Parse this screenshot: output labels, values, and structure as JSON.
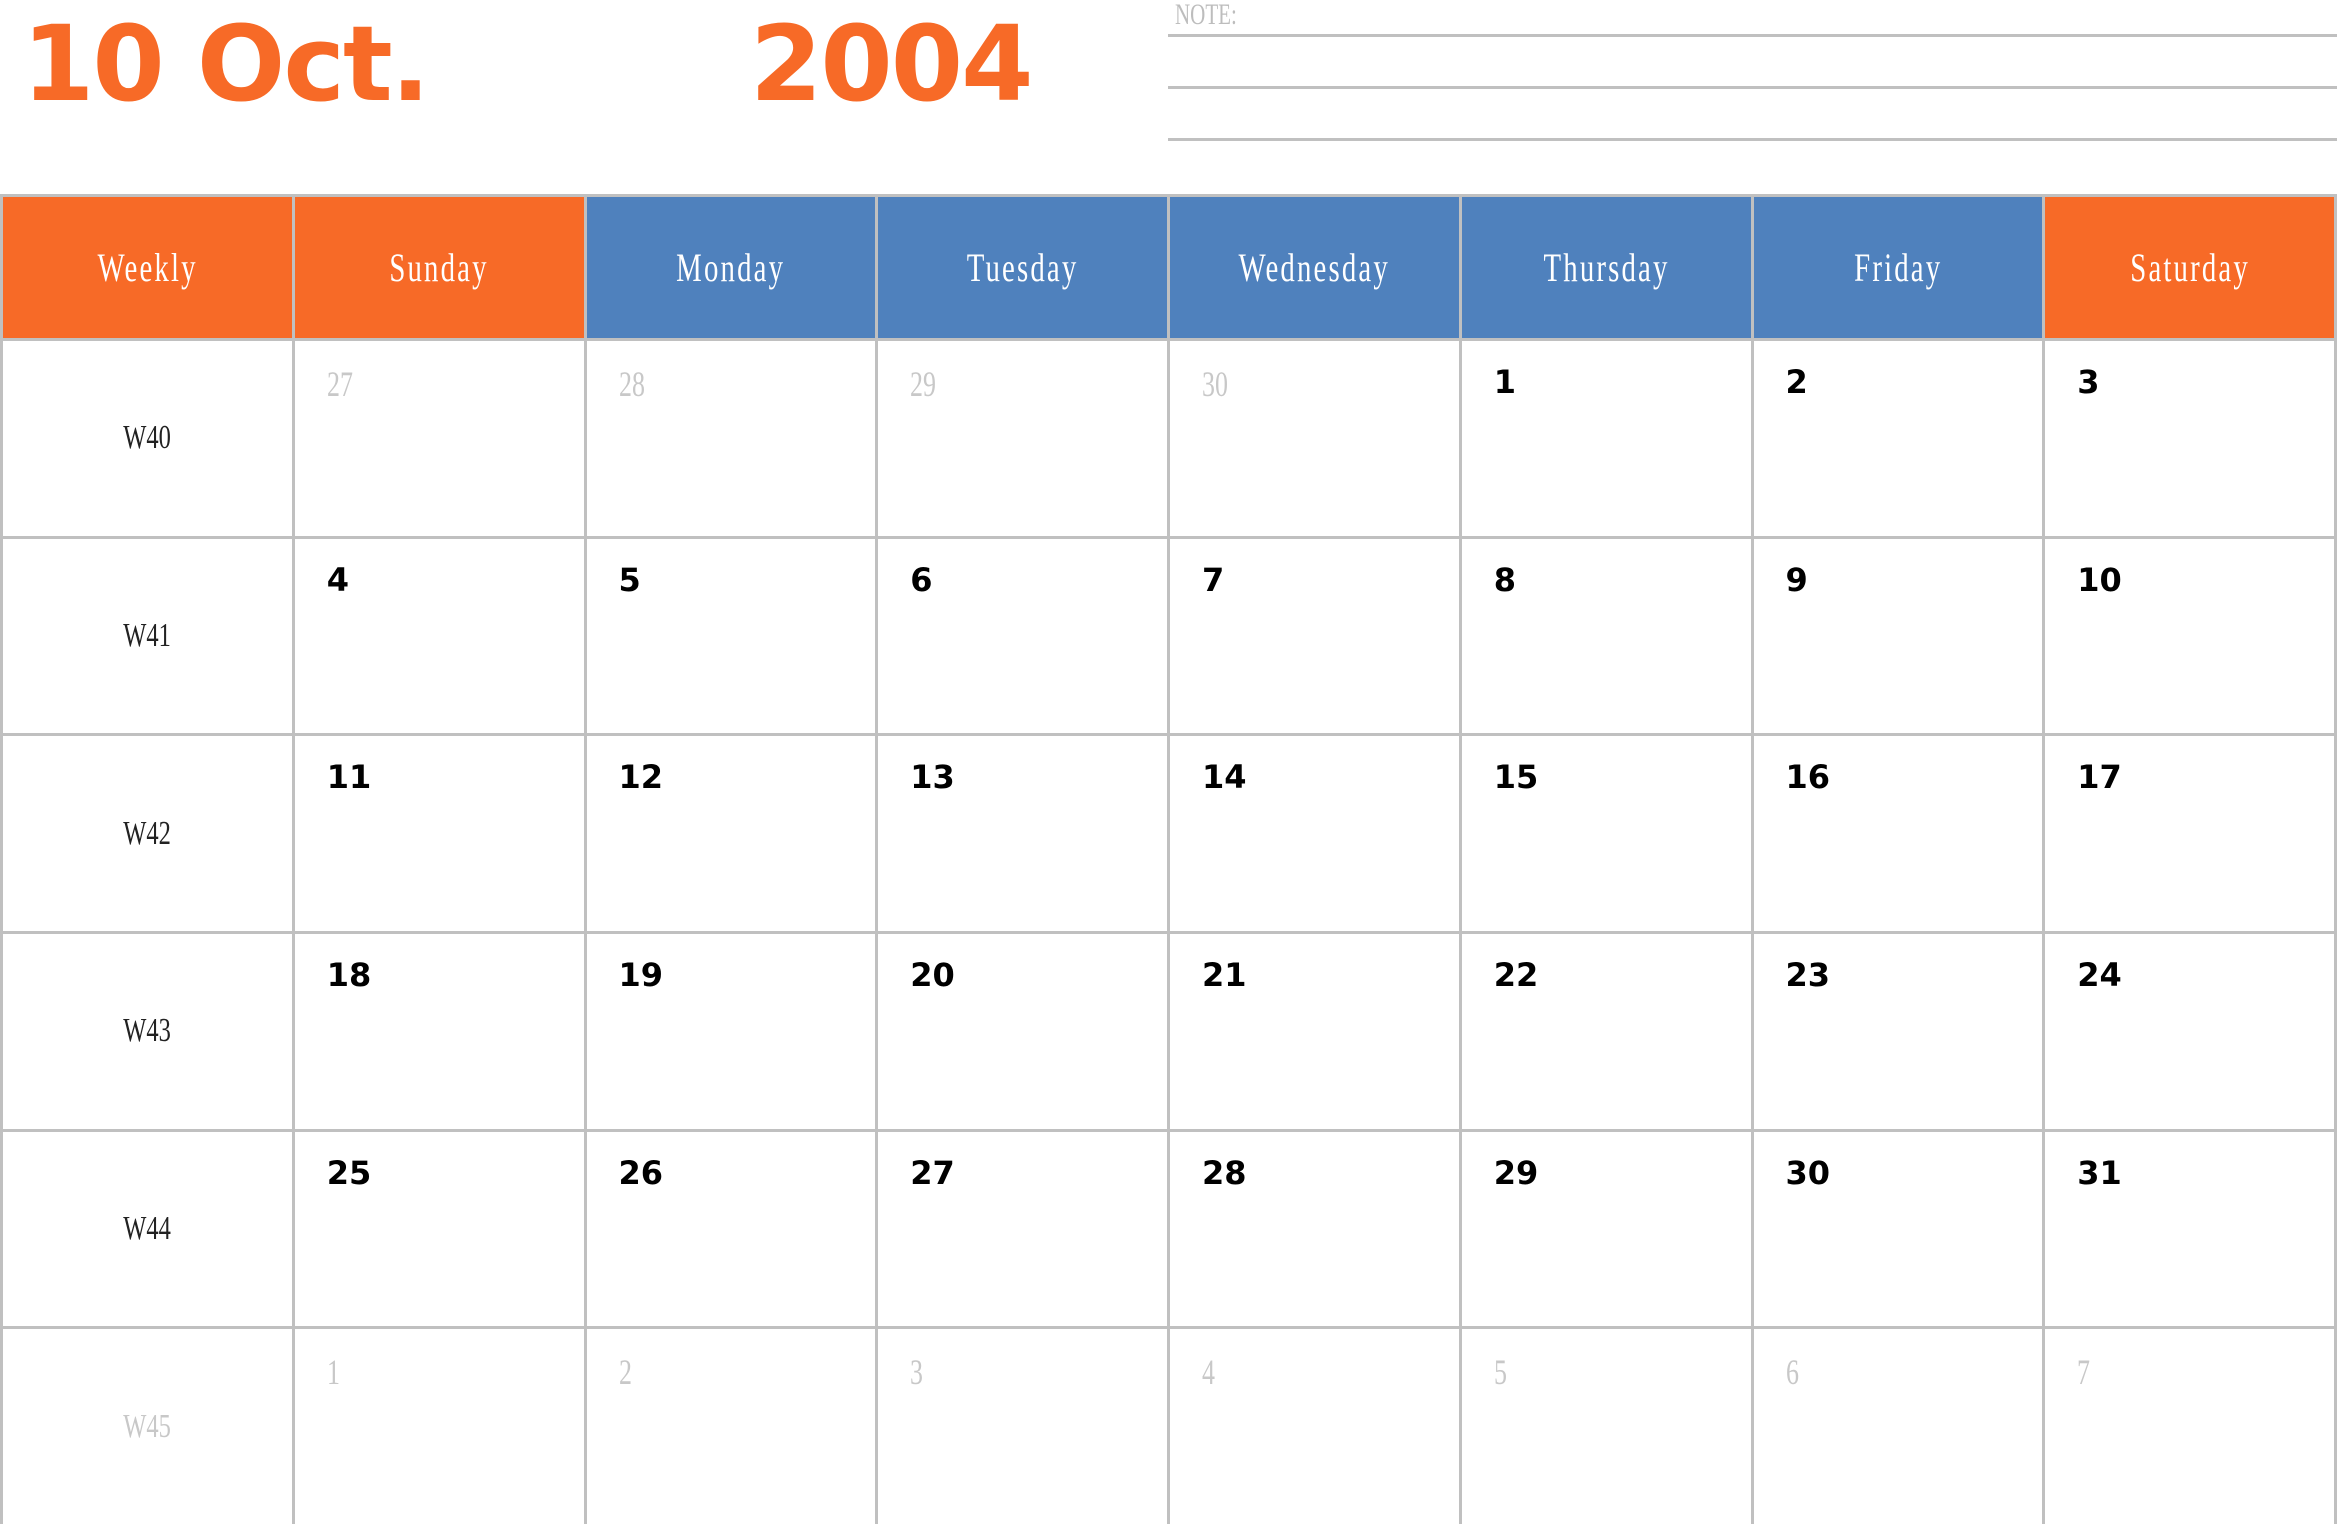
{
  "header": {
    "date_label": "10 Oct.",
    "year": "2004",
    "note_label": "NOTE:"
  },
  "colors": {
    "accent_orange": "#f76a27",
    "accent_blue": "#4f81bd",
    "grid_gray": "#c0c0c0",
    "muted_text": "#c8c8c8"
  },
  "columns": [
    {
      "label": "Weekly",
      "color": "orange"
    },
    {
      "label": "Sunday",
      "color": "orange"
    },
    {
      "label": "Monday",
      "color": "blue"
    },
    {
      "label": "Tuesday",
      "color": "blue"
    },
    {
      "label": "Wednesday",
      "color": "blue"
    },
    {
      "label": "Thursday",
      "color": "blue"
    },
    {
      "label": "Friday",
      "color": "blue"
    },
    {
      "label": "Saturday",
      "color": "orange"
    }
  ],
  "weeks": [
    {
      "week": "W40",
      "muted": false,
      "days": [
        {
          "d": "27",
          "muted": true
        },
        {
          "d": "28",
          "muted": true
        },
        {
          "d": "29",
          "muted": true
        },
        {
          "d": "30",
          "muted": true
        },
        {
          "d": "1",
          "muted": false
        },
        {
          "d": "2",
          "muted": false
        },
        {
          "d": "3",
          "muted": false
        }
      ]
    },
    {
      "week": "W41",
      "muted": false,
      "days": [
        {
          "d": "4",
          "muted": false
        },
        {
          "d": "5",
          "muted": false
        },
        {
          "d": "6",
          "muted": false
        },
        {
          "d": "7",
          "muted": false
        },
        {
          "d": "8",
          "muted": false
        },
        {
          "d": "9",
          "muted": false
        },
        {
          "d": "10",
          "muted": false
        }
      ]
    },
    {
      "week": "W42",
      "muted": false,
      "days": [
        {
          "d": "11",
          "muted": false
        },
        {
          "d": "12",
          "muted": false
        },
        {
          "d": "13",
          "muted": false
        },
        {
          "d": "14",
          "muted": false
        },
        {
          "d": "15",
          "muted": false
        },
        {
          "d": "16",
          "muted": false
        },
        {
          "d": "17",
          "muted": false
        }
      ]
    },
    {
      "week": "W43",
      "muted": false,
      "days": [
        {
          "d": "18",
          "muted": false
        },
        {
          "d": "19",
          "muted": false
        },
        {
          "d": "20",
          "muted": false
        },
        {
          "d": "21",
          "muted": false
        },
        {
          "d": "22",
          "muted": false
        },
        {
          "d": "23",
          "muted": false
        },
        {
          "d": "24",
          "muted": false
        }
      ]
    },
    {
      "week": "W44",
      "muted": false,
      "days": [
        {
          "d": "25",
          "muted": false
        },
        {
          "d": "26",
          "muted": false
        },
        {
          "d": "27",
          "muted": false
        },
        {
          "d": "28",
          "muted": false
        },
        {
          "d": "29",
          "muted": false
        },
        {
          "d": "30",
          "muted": false
        },
        {
          "d": "31",
          "muted": false
        }
      ]
    },
    {
      "week": "W45",
      "muted": true,
      "days": [
        {
          "d": "1",
          "muted": true
        },
        {
          "d": "2",
          "muted": true
        },
        {
          "d": "3",
          "muted": true
        },
        {
          "d": "4",
          "muted": true
        },
        {
          "d": "5",
          "muted": true
        },
        {
          "d": "6",
          "muted": true
        },
        {
          "d": "7",
          "muted": true
        }
      ]
    }
  ]
}
